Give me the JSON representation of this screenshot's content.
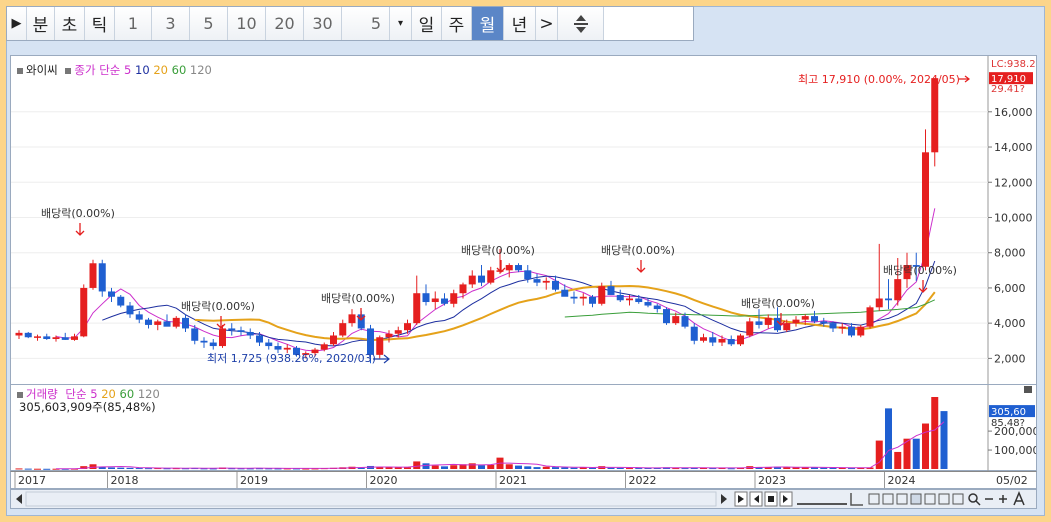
{
  "toolbar": {
    "play": "▶",
    "periods": [
      "분",
      "초",
      "틱"
    ],
    "numbers": [
      "1",
      "3",
      "5",
      "10",
      "20",
      "30"
    ],
    "count": "5",
    "dropdown": "▾",
    "units": [
      "일",
      "주",
      "월",
      "년"
    ],
    "active_unit": "월",
    "next": ">"
  },
  "legend": {
    "name": "와이씨",
    "ma_label": "종가 단순",
    "ma_periods": [
      "5",
      "10",
      "20",
      "60",
      "120"
    ]
  },
  "volume_legend": {
    "name": "거래량",
    "ma_label": "단순",
    "ma_periods": [
      "5",
      "20",
      "60",
      "120"
    ],
    "value": "305,603,909주(85,48%)"
  },
  "colors": {
    "up": "#e51f1f",
    "down": "#1f5fd1",
    "ma5": "#cc2fcc",
    "ma10": "#1d2fa0",
    "ma20": "#e5a21a",
    "ma60": "#3a9e3a",
    "ma120": "#888888"
  },
  "chart_data": {
    "type": "candlestick",
    "y_ticks": [
      "2,000",
      "4,000",
      "6,000",
      "8,000",
      "10,000",
      "12,000",
      "14,000",
      "16,000"
    ],
    "y_tick_values": [
      2000,
      4000,
      6000,
      8000,
      10000,
      12000,
      14000,
      16000
    ],
    "ylim": [
      1000,
      18600
    ],
    "right_labels": {
      "top": "LC:938.2",
      "high": "29.41?",
      "current": "17,910"
    },
    "x_ticks": [
      "2017",
      "2018",
      "2019",
      "2020",
      "2021",
      "2022",
      "2023",
      "2024",
      "05/02"
    ],
    "annotations": {
      "high": "최고 17,910 (0.00%, 2024/05)",
      "low": "최저 1,725 (938.26%, 2020/03)",
      "dividends": [
        "배당락(0.00%)",
        "배당락(0.00%)",
        "배당락(0.00%)",
        "배당락(0.00%)",
        "배당락(0.00%)",
        "배당락(0.00%)",
        "배당락(0.00%)"
      ]
    },
    "volume_ticks": [
      "100,000",
      "200,000"
    ],
    "volume_tick_values": [
      100000,
      200000
    ],
    "volume_right_labels": {
      "current": "305,60",
      "pct": "85.48?"
    },
    "candles": [
      {
        "o": 3300,
        "h": 3600,
        "l": 3100,
        "c": 3450
      },
      {
        "o": 3450,
        "h": 3500,
        "l": 3150,
        "c": 3200
      },
      {
        "o": 3200,
        "h": 3350,
        "l": 3000,
        "c": 3250
      },
      {
        "o": 3250,
        "h": 3400,
        "l": 3050,
        "c": 3100
      },
      {
        "o": 3100,
        "h": 3300,
        "l": 2950,
        "c": 3200
      },
      {
        "o": 3200,
        "h": 3450,
        "l": 3050,
        "c": 3050
      },
      {
        "o": 3050,
        "h": 3400,
        "l": 3000,
        "c": 3250
      },
      {
        "o": 3250,
        "h": 6200,
        "l": 3200,
        "c": 6000
      },
      {
        "o": 6000,
        "h": 7600,
        "l": 5900,
        "c": 7400
      },
      {
        "o": 7400,
        "h": 7600,
        "l": 5500,
        "c": 5800
      },
      {
        "o": 5800,
        "h": 6000,
        "l": 5200,
        "c": 5500
      },
      {
        "o": 5500,
        "h": 5600,
        "l": 4900,
        "c": 5000
      },
      {
        "o": 5000,
        "h": 5200,
        "l": 4300,
        "c": 4500
      },
      {
        "o": 4500,
        "h": 4700,
        "l": 4000,
        "c": 4200
      },
      {
        "o": 4200,
        "h": 4300,
        "l": 3700,
        "c": 3900
      },
      {
        "o": 3900,
        "h": 4200,
        "l": 3600,
        "c": 4100
      },
      {
        "o": 4100,
        "h": 4500,
        "l": 3900,
        "c": 3800
      },
      {
        "o": 3800,
        "h": 4400,
        "l": 3700,
        "c": 4300
      },
      {
        "o": 4300,
        "h": 4500,
        "l": 3500,
        "c": 3700
      },
      {
        "o": 3700,
        "h": 3900,
        "l": 2800,
        "c": 3000
      },
      {
        "o": 3000,
        "h": 3200,
        "l": 2600,
        "c": 2900
      },
      {
        "o": 2900,
        "h": 3100,
        "l": 2500,
        "c": 2700
      },
      {
        "o": 2700,
        "h": 3900,
        "l": 2600,
        "c": 3700
      },
      {
        "o": 3700,
        "h": 4000,
        "l": 3300,
        "c": 3600
      },
      {
        "o": 3600,
        "h": 3800,
        "l": 3300,
        "c": 3500
      },
      {
        "o": 3500,
        "h": 3700,
        "l": 3100,
        "c": 3300
      },
      {
        "o": 3300,
        "h": 3500,
        "l": 2700,
        "c": 2900
      },
      {
        "o": 2900,
        "h": 3100,
        "l": 2500,
        "c": 2700
      },
      {
        "o": 2700,
        "h": 2900,
        "l": 2300,
        "c": 2500
      },
      {
        "o": 2500,
        "h": 2800,
        "l": 2300,
        "c": 2600
      },
      {
        "o": 2600,
        "h": 2700,
        "l": 2100,
        "c": 2200
      },
      {
        "o": 2200,
        "h": 2400,
        "l": 2000,
        "c": 2300
      },
      {
        "o": 2300,
        "h": 2600,
        "l": 2100,
        "c": 2500
      },
      {
        "o": 2500,
        "h": 2900,
        "l": 2400,
        "c": 2800
      },
      {
        "o": 2800,
        "h": 3500,
        "l": 2700,
        "c": 3300
      },
      {
        "o": 3300,
        "h": 4200,
        "l": 3200,
        "c": 4000
      },
      {
        "o": 4000,
        "h": 4800,
        "l": 3800,
        "c": 4500
      },
      {
        "o": 4500,
        "h": 4700,
        "l": 3600,
        "c": 3700
      },
      {
        "o": 3700,
        "h": 3900,
        "l": 1725,
        "c": 2200
      },
      {
        "o": 2200,
        "h": 3300,
        "l": 2000,
        "c": 3200
      },
      {
        "o": 3200,
        "h": 3600,
        "l": 2900,
        "c": 3400
      },
      {
        "o": 3400,
        "h": 3800,
        "l": 3200,
        "c": 3600
      },
      {
        "o": 3600,
        "h": 4200,
        "l": 3400,
        "c": 4000
      },
      {
        "o": 4000,
        "h": 6700,
        "l": 3900,
        "c": 5700
      },
      {
        "o": 5700,
        "h": 6200,
        "l": 5000,
        "c": 5200
      },
      {
        "o": 5200,
        "h": 5800,
        "l": 4800,
        "c": 5400
      },
      {
        "o": 5400,
        "h": 5700,
        "l": 5000,
        "c": 5100
      },
      {
        "o": 5100,
        "h": 5900,
        "l": 4900,
        "c": 5700
      },
      {
        "o": 5700,
        "h": 6300,
        "l": 5400,
        "c": 6200
      },
      {
        "o": 6200,
        "h": 7000,
        "l": 6000,
        "c": 6700
      },
      {
        "o": 6700,
        "h": 7300,
        "l": 6100,
        "c": 6300
      },
      {
        "o": 6300,
        "h": 7200,
        "l": 6200,
        "c": 7000
      },
      {
        "o": 7000,
        "h": 8200,
        "l": 6800,
        "c": 7000
      },
      {
        "o": 7000,
        "h": 7400,
        "l": 6600,
        "c": 7300
      },
      {
        "o": 7300,
        "h": 7400,
        "l": 6900,
        "c": 7000
      },
      {
        "o": 7000,
        "h": 7300,
        "l": 6300,
        "c": 6500
      },
      {
        "o": 6500,
        "h": 6800,
        "l": 6100,
        "c": 6300
      },
      {
        "o": 6300,
        "h": 6600,
        "l": 5900,
        "c": 6400
      },
      {
        "o": 6400,
        "h": 6700,
        "l": 5800,
        "c": 5900
      },
      {
        "o": 5900,
        "h": 6200,
        "l": 5600,
        "c": 5500
      },
      {
        "o": 5500,
        "h": 5800,
        "l": 5100,
        "c": 5400
      },
      {
        "o": 5400,
        "h": 5700,
        "l": 5000,
        "c": 5500
      },
      {
        "o": 5500,
        "h": 5600,
        "l": 4900,
        "c": 5100
      },
      {
        "o": 5100,
        "h": 6300,
        "l": 5000,
        "c": 6100
      },
      {
        "o": 6100,
        "h": 6400,
        "l": 5700,
        "c": 5600
      },
      {
        "o": 5600,
        "h": 5900,
        "l": 5200,
        "c": 5300
      },
      {
        "o": 5300,
        "h": 5600,
        "l": 5000,
        "c": 5400
      },
      {
        "o": 5400,
        "h": 5600,
        "l": 5100,
        "c": 5200
      },
      {
        "o": 5200,
        "h": 5400,
        "l": 4900,
        "c": 5000
      },
      {
        "o": 5000,
        "h": 5100,
        "l": 4600,
        "c": 4800
      },
      {
        "o": 4800,
        "h": 4900,
        "l": 3900,
        "c": 4000
      },
      {
        "o": 4000,
        "h": 4600,
        "l": 3900,
        "c": 4400
      },
      {
        "o": 4400,
        "h": 4600,
        "l": 3700,
        "c": 3800
      },
      {
        "o": 3800,
        "h": 4000,
        "l": 2800,
        "c": 3000
      },
      {
        "o": 3000,
        "h": 3400,
        "l": 2900,
        "c": 3200
      },
      {
        "o": 3200,
        "h": 3500,
        "l": 2700,
        "c": 2900
      },
      {
        "o": 2900,
        "h": 3300,
        "l": 2700,
        "c": 3100
      },
      {
        "o": 3100,
        "h": 3300,
        "l": 2700,
        "c": 2800
      },
      {
        "o": 2800,
        "h": 3400,
        "l": 2700,
        "c": 3300
      },
      {
        "o": 3300,
        "h": 4300,
        "l": 3200,
        "c": 4100
      },
      {
        "o": 4100,
        "h": 4800,
        "l": 3700,
        "c": 3900
      },
      {
        "o": 3900,
        "h": 4500,
        "l": 3700,
        "c": 4300
      },
      {
        "o": 4300,
        "h": 4900,
        "l": 3500,
        "c": 3600
      },
      {
        "o": 3600,
        "h": 4200,
        "l": 3500,
        "c": 4000
      },
      {
        "o": 4000,
        "h": 4400,
        "l": 3800,
        "c": 4200
      },
      {
        "o": 4200,
        "h": 4500,
        "l": 3900,
        "c": 4400
      },
      {
        "o": 4400,
        "h": 4700,
        "l": 4000,
        "c": 4100
      },
      {
        "o": 4100,
        "h": 4300,
        "l": 3800,
        "c": 4000
      },
      {
        "o": 4000,
        "h": 4100,
        "l": 3500,
        "c": 3700
      },
      {
        "o": 3700,
        "h": 4000,
        "l": 3400,
        "c": 3800
      },
      {
        "o": 3800,
        "h": 4000,
        "l": 3200,
        "c": 3300
      },
      {
        "o": 3300,
        "h": 3900,
        "l": 3200,
        "c": 3800
      },
      {
        "o": 3800,
        "h": 5000,
        "l": 3700,
        "c": 4900
      },
      {
        "o": 4900,
        "h": 8500,
        "l": 4700,
        "c": 5400
      },
      {
        "o": 5400,
        "h": 6500,
        "l": 4800,
        "c": 5300
      },
      {
        "o": 5300,
        "h": 7700,
        "l": 5000,
        "c": 6500
      },
      {
        "o": 6500,
        "h": 8000,
        "l": 6000,
        "c": 7300
      },
      {
        "o": 7300,
        "h": 8000,
        "l": 6400,
        "c": 7200
      },
      {
        "o": 7200,
        "h": 15000,
        "l": 7000,
        "c": 13700
      },
      {
        "o": 13700,
        "h": 17910,
        "l": 12900,
        "c": 17910
      }
    ],
    "volumes": [
      3000,
      2000,
      1500,
      1200,
      1500,
      1300,
      1800,
      15000,
      25000,
      12000,
      8000,
      7000,
      6000,
      5000,
      4500,
      5000,
      4000,
      4500,
      4000,
      5000,
      3500,
      3000,
      8000,
      4000,
      3500,
      3200,
      4000,
      3500,
      3000,
      3200,
      3000,
      2500,
      3000,
      4500,
      6000,
      9000,
      12000,
      7000,
      16000,
      10000,
      8000,
      9000,
      8000,
      40000,
      30000,
      18000,
      14000,
      20000,
      25000,
      30000,
      20000,
      22000,
      60000,
      25000,
      18000,
      14000,
      10000,
      12000,
      10000,
      8000,
      7000,
      8000,
      6000,
      15000,
      7000,
      6000,
      5000,
      5000,
      6000,
      6000,
      9000,
      5000,
      5000,
      8000,
      6000,
      5000,
      6000,
      4000,
      8000,
      15000,
      10000,
      9000,
      12000,
      8000,
      9000,
      8000,
      10000,
      7000,
      6000,
      7000,
      5000,
      6000,
      8000,
      150000,
      320000,
      90000,
      160000,
      160000,
      240000,
      380000,
      305603
    ]
  }
}
